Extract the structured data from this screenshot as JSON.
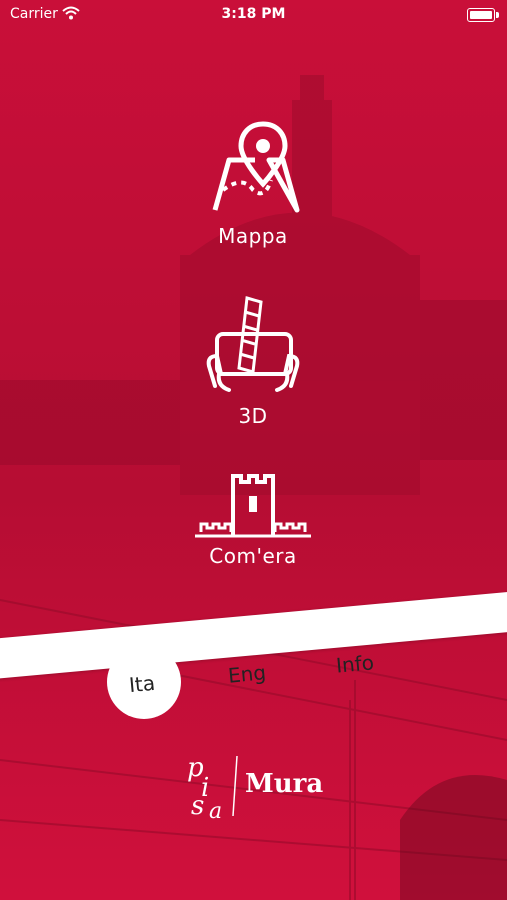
{
  "status_bar": {
    "carrier": "Carrier",
    "time": "3:18 PM"
  },
  "menu": {
    "map_label": "Mappa",
    "threed_label": "3D",
    "history_label": "Com'era"
  },
  "languages": [
    "Ita",
    "Eng",
    "Info"
  ],
  "selected_language": "Ita",
  "logo": {
    "left": "pisa",
    "right": "Mura"
  },
  "colors": {
    "primary": "#c8103a",
    "band": "#ffffff",
    "icon": "#ffffff"
  }
}
